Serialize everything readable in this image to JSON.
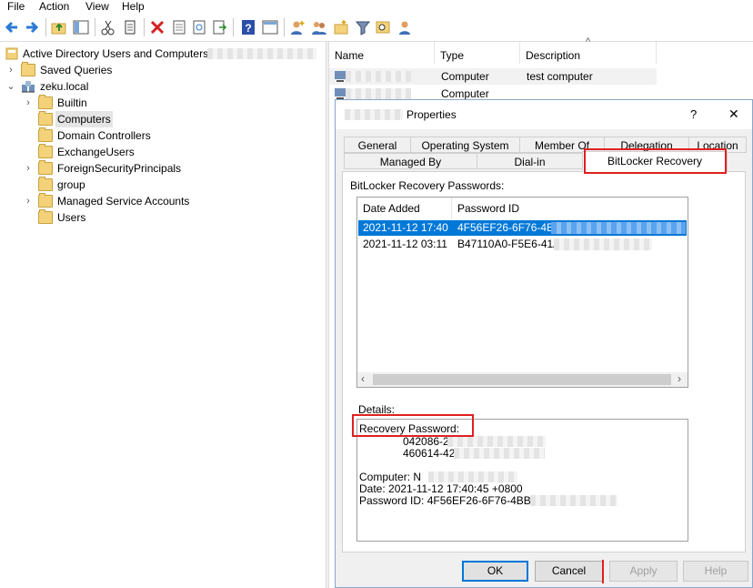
{
  "menu": [
    "File",
    "Action",
    "View",
    "Help"
  ],
  "tree": {
    "root": "Active Directory Users and Computers",
    "saved_queries": "Saved Queries",
    "domain": "zeku.local",
    "children": [
      "Builtin",
      "Computers",
      "Domain Controllers",
      "ExchangeUsers",
      "ForeignSecurityPrincipals",
      "group",
      "Managed Service Accounts",
      "Users"
    ]
  },
  "list": {
    "headers": [
      "Name",
      "Type",
      "Description"
    ],
    "rows": [
      {
        "type": "Computer",
        "description": "test computer"
      },
      {
        "type": "Computer",
        "description": ""
      }
    ]
  },
  "dialog": {
    "title": "Properties",
    "help": "?",
    "close": "✕",
    "tabs_row1": [
      "General",
      "Operating System",
      "Member Of",
      "Delegation",
      "Location"
    ],
    "tabs_row2": [
      "Managed By",
      "Dial-in",
      "BitLocker Recovery"
    ],
    "passwords_label": "BitLocker Recovery Passwords:",
    "table_headers": [
      "Date Added",
      "Password ID"
    ],
    "rows": [
      {
        "date": "2021-11-12 17:40",
        "id": "4F56EF26-6F76-4BB9"
      },
      {
        "date": "2021-11-12 03:11",
        "id": "B47110A0-F5E6-41A3"
      }
    ],
    "details_label": "Details:",
    "details": {
      "recovery_label": "Recovery Password:",
      "line1": "042086-2",
      "line2": "460614-42",
      "computer": "Computer: N",
      "date": "Date: 2021-11-12 17:40:45 +0800",
      "password_id": "Password ID: 4F56EF26-6F76-4BB9-B"
    },
    "buttons": {
      "ok": "OK",
      "cancel": "Cancel",
      "apply": "Apply",
      "help": "Help"
    }
  },
  "colors": {
    "selection": "#0078d7",
    "highlight_box": "#e02020"
  }
}
